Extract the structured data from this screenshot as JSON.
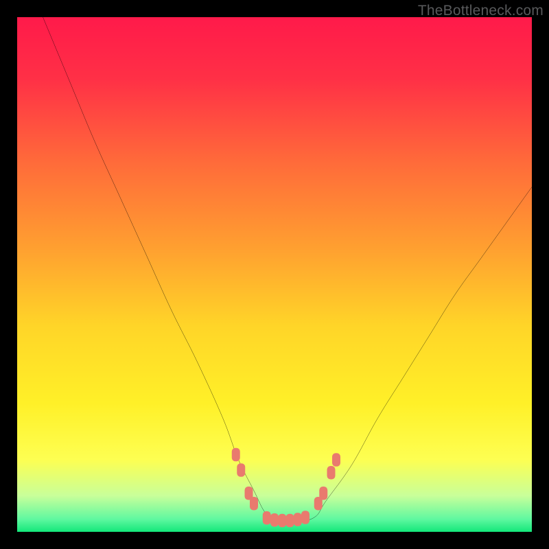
{
  "watermark": "TheBottleneck.com",
  "colors": {
    "black": "#000000",
    "curve": "#000000",
    "marker": "#e97a6e",
    "watermark_text": "#58595b",
    "gradient_stops": [
      {
        "offset": 0.0,
        "color": "#ff1a4a"
      },
      {
        "offset": 0.12,
        "color": "#ff3046"
      },
      {
        "offset": 0.28,
        "color": "#ff6a3a"
      },
      {
        "offset": 0.45,
        "color": "#ffa030"
      },
      {
        "offset": 0.6,
        "color": "#ffd528"
      },
      {
        "offset": 0.75,
        "color": "#fff028"
      },
      {
        "offset": 0.86,
        "color": "#fdff52"
      },
      {
        "offset": 0.93,
        "color": "#c8ff9a"
      },
      {
        "offset": 0.975,
        "color": "#60f8a0"
      },
      {
        "offset": 1.0,
        "color": "#13e77a"
      }
    ]
  },
  "chart_data": {
    "type": "line",
    "title": "",
    "xlabel": "",
    "ylabel": "",
    "xlim": [
      0,
      100
    ],
    "ylim": [
      0,
      100
    ],
    "grid": false,
    "legend": false,
    "note": "Values are relative (0-100) estimates of the plotted curve position in percent of plot area. y=100 is top edge, y=0 is bottom edge.",
    "series": [
      {
        "name": "bottleneck-curve",
        "x": [
          5,
          10,
          15,
          20,
          25,
          30,
          35,
          40,
          43,
          46,
          48,
          50,
          52,
          55,
          58,
          60,
          65,
          70,
          75,
          80,
          85,
          90,
          95,
          100
        ],
        "y": [
          100,
          88,
          76,
          65,
          54,
          43,
          33,
          22,
          14,
          8,
          4,
          2,
          2,
          2,
          3,
          6,
          13,
          22,
          30,
          38,
          46,
          53,
          60,
          67
        ]
      }
    ],
    "markers": {
      "name": "highlighted-points",
      "note": "Rounded-rectangle markers near the trough of the curve (approximate positions, percent coords).",
      "points": [
        {
          "x": 42.5,
          "y": 15
        },
        {
          "x": 43.5,
          "y": 12
        },
        {
          "x": 45.0,
          "y": 7.5
        },
        {
          "x": 46.0,
          "y": 5.5
        },
        {
          "x": 48.5,
          "y": 2.7
        },
        {
          "x": 50.0,
          "y": 2.3
        },
        {
          "x": 51.5,
          "y": 2.2
        },
        {
          "x": 53.0,
          "y": 2.2
        },
        {
          "x": 54.5,
          "y": 2.4
        },
        {
          "x": 56.0,
          "y": 2.8
        },
        {
          "x": 58.5,
          "y": 5.5
        },
        {
          "x": 59.5,
          "y": 7.5
        },
        {
          "x": 61.0,
          "y": 11.5
        },
        {
          "x": 62.0,
          "y": 14
        }
      ]
    }
  }
}
